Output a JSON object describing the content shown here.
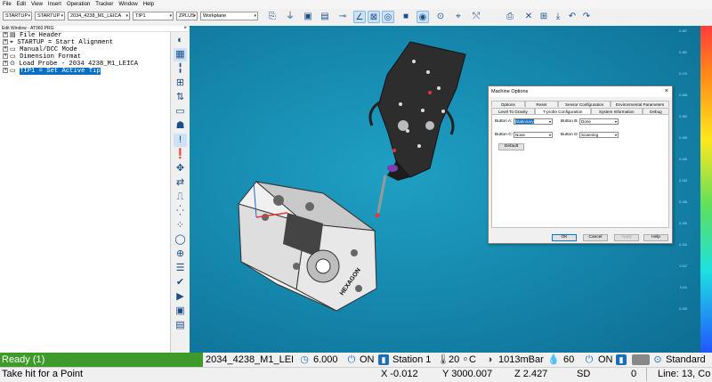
{
  "menu": [
    "File",
    "Edit",
    "View",
    "Insert",
    "Operation",
    "Tracker",
    "Window",
    "Help"
  ],
  "toolbar": {
    "combos": [
      "STARTUP",
      "STARTUP",
      "2034_4238_M1_LEICA",
      "TIP1",
      "ZPLUS",
      "Workplane"
    ],
    "icons": [
      "import-icon",
      "probe-icon",
      "save-icon",
      "display-icon",
      "measure-icon",
      "angle-icon",
      "box-icon",
      "ball-icon",
      "target-icon",
      "camera-icon",
      "target2-icon",
      "tracker-icon",
      "laser-icon",
      "printer-icon",
      "close-icon",
      "scan-icon",
      "download-icon",
      "undo-icon",
      "redo-icon"
    ]
  },
  "edit_window": {
    "title": "Edit Window - AT960.PRG",
    "lines": [
      "File Header",
      "STARTUP = Start Alignment",
      "Manual/DCC Mode",
      "Dimension Format",
      "Load Probe - 2034 4238_M1_LEICA",
      "TIP1 = Set Active Tip"
    ]
  },
  "viewport": {
    "brand": "HEXAGON"
  },
  "scale_labels": [
    "0.187",
    "0.181",
    "0.174",
    "0.168",
    "0.162",
    "0.155",
    "0.149",
    "0.143",
    "0.136",
    "0.130",
    "0.124",
    "0.117",
    "0.111",
    "0.105"
  ],
  "dialog": {
    "title": "Machine Options",
    "tabs_row1": [
      "Options",
      "Reset",
      "Sensor Configuration",
      "Environmental Parameters"
    ],
    "tabs_row2": [
      "Level To Gravity",
      "T-probe Configuration",
      "System Information",
      "Debug"
    ],
    "button_a_label": "Button A:",
    "button_a_value": "Stationary",
    "button_b_label": "Button B:",
    "button_b_value": "Done",
    "button_c_label": "Button C:",
    "button_c_value": "None",
    "button_d_label": "Button D:",
    "button_d_value": "Scanning",
    "default_label": "Default",
    "ok": "OK",
    "cancel": "Cancel",
    "apply": "Apply",
    "help": "Help"
  },
  "status": {
    "ready": "Ready (1)",
    "probe": "2034_4238_M1_LEI",
    "value1": "6.000",
    "on1": "ON",
    "station": "Station 1",
    "temp": "20",
    "temp_unit": "C",
    "pressure": "1013mBar",
    "humidity": "60",
    "on2": "ON",
    "mode": "Standard",
    "prompt": "Take hit for a Point",
    "x": "X -0.012",
    "y": "Y 3000.007",
    "z": "Z 2.427",
    "sd": "SD",
    "zero": "0",
    "line": "Line: 13, Co"
  },
  "colors": {
    "ready_bg": "#3e9b2b",
    "viewport_bg": "#1585ab",
    "selection": "#0a6fc2"
  }
}
